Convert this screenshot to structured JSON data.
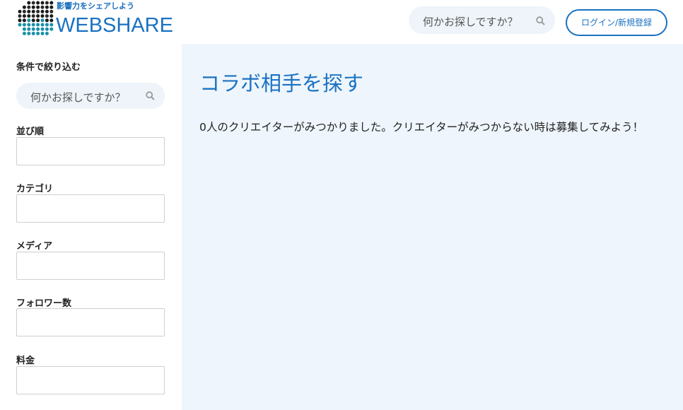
{
  "header": {
    "tagline": "影響力をシェアしよう",
    "brand": "WEBSHARE",
    "search_placeholder": "何かお探しですか？",
    "login_label": "ログイン/新規登録"
  },
  "sidebar": {
    "title": "条件で絞り込む",
    "search_placeholder": "何かお探しですか？",
    "filters": [
      {
        "label": "並び順",
        "value": ""
      },
      {
        "label": "カテゴリ",
        "value": ""
      },
      {
        "label": "メディア",
        "value": ""
      },
      {
        "label": "フォロワー数",
        "value": ""
      },
      {
        "label": "料金",
        "value": ""
      }
    ]
  },
  "main": {
    "title": "コラボ相手を探す",
    "result_message": "0人のクリエイターがみつかりました。クリエイターがみつからない時は募集してみよう！"
  },
  "colors": {
    "brand": "#1a72c2",
    "main_background": "#eef5fc",
    "search_background": "#eef4f9"
  }
}
